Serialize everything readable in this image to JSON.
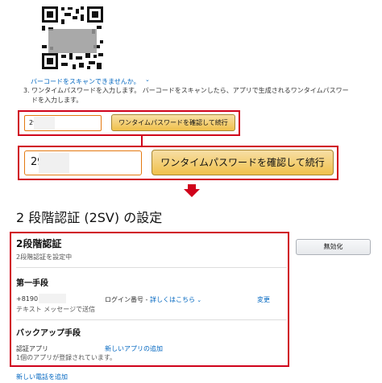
{
  "setup": {
    "cant_scan_link": "バーコードをスキャンできませんか。",
    "step3_line1": "3. ワンタイムパスワードを入力します。 バーコードをスキャンしたら、アプリで生成されるワンタイムパスワー",
    "step3_line2": "ドを入力します。",
    "code_value": "29",
    "verify_button": "ワンタイムパスワードを確認して続行"
  },
  "settings": {
    "page_title": "2 段階認証 (2SV) の設定",
    "section_title": "2段階認証",
    "status": "2段階認証を設定中",
    "disable_button": "無効化",
    "primary": {
      "heading": "第一手段",
      "phone": "+8190",
      "method": "テキスト メッセージで送信",
      "login_label": "ログイン番号 - ",
      "details_link": "詳しくはこちら",
      "change_link": "変更"
    },
    "backup": {
      "heading": "バックアップ手段",
      "auth_app_label": "認証アプリ",
      "auth_app_desc": "1個のアプリが登録されています。",
      "add_app_link": "新しいアプリの追加",
      "add_phone_link": "新しい電話を追加"
    }
  }
}
